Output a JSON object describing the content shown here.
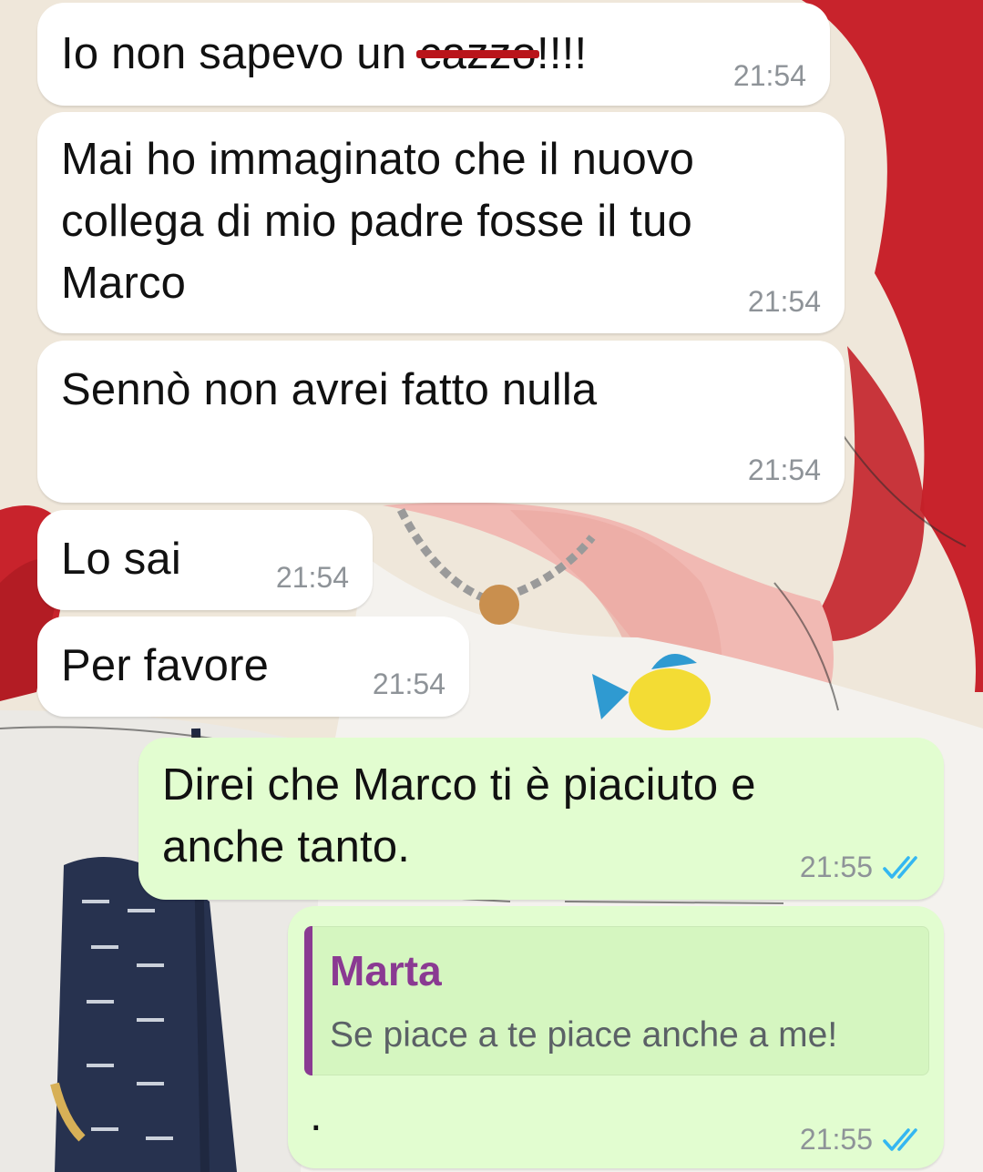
{
  "chat": {
    "messages": [
      {
        "text": "Io non sapevo un ",
        "censored": "cazzo",
        "suffix": "!!!!",
        "time": "21:54"
      },
      {
        "lines": [
          "Mai ho immaginato che il nuovo",
          "collega di mio padre fosse il tuo",
          "Marco"
        ],
        "time": "21:54"
      },
      {
        "text": "Sennò non avrei fatto nulla",
        "time": "21:54"
      },
      {
        "text": "Lo sai",
        "time": "21:54"
      },
      {
        "text": "Per favore",
        "time": "21:54"
      },
      {
        "lines": [
          "Direi che Marco ti è piaciuto e",
          "anche tanto."
        ],
        "time": "21:55"
      },
      {
        "quote": {
          "author": "Marta",
          "text": "Se piace a te piace anche a me!"
        },
        "text": ".",
        "time": "21:55"
      }
    ]
  },
  "colors": {
    "incoming_bubble": "#ffffff",
    "outgoing_bubble": "#e2fdd0",
    "read_ticks": "#34b7f1",
    "quote_accent": "#8a3a92",
    "censor_line": "#b9141a"
  },
  "icons": {
    "read_status": "double-check-icon"
  }
}
